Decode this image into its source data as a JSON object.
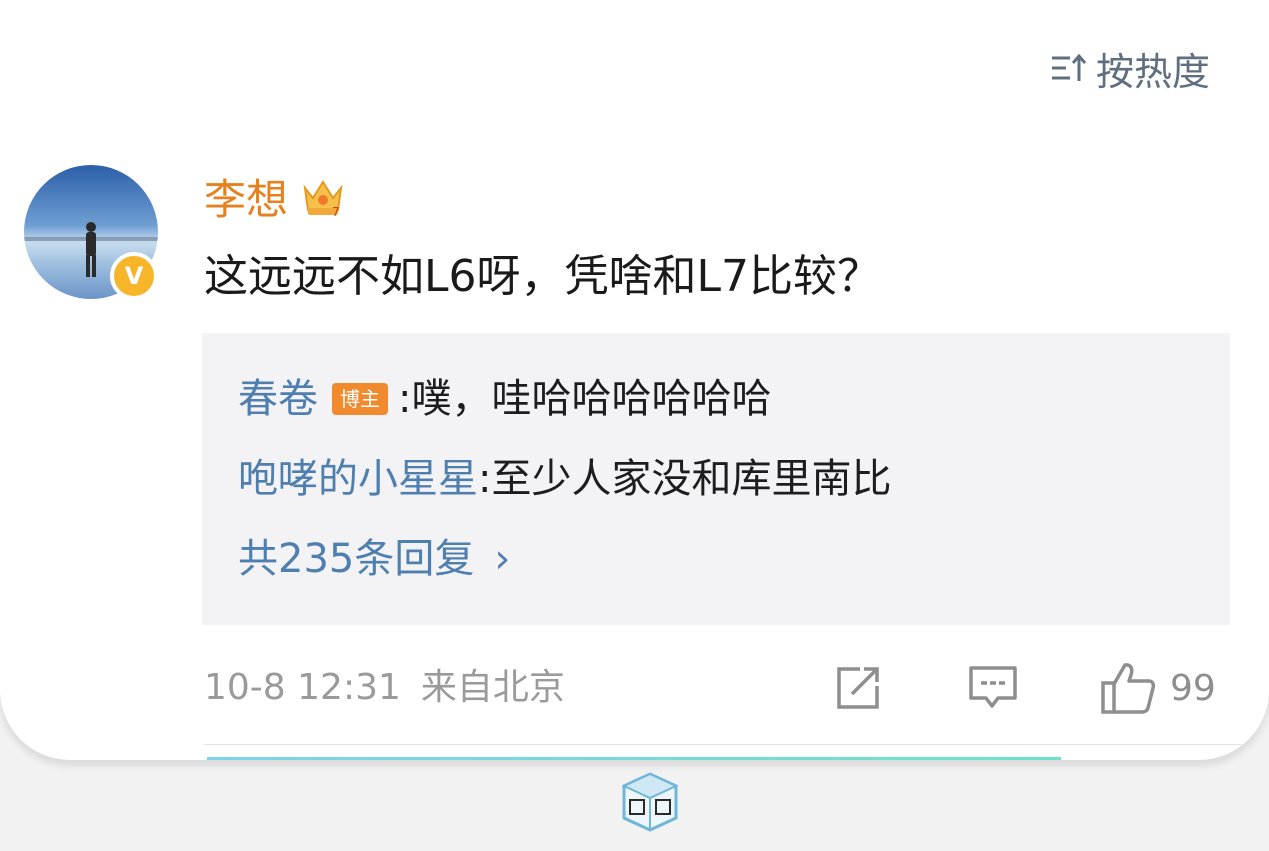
{
  "sort": {
    "icon": "sort-icon",
    "label": "按热度"
  },
  "comment": {
    "author": "李想",
    "author_color": "#e6811f",
    "crown_icon": "crown-icon",
    "verified_icon": "verified-v-badge",
    "verified_glyph": "V",
    "text": "这远远不如L6呀，凭啥和L7比较？",
    "timestamp": "10-8 12:31",
    "location": "来自北京"
  },
  "replies": [
    {
      "name": "春卷",
      "badge": "博主",
      "separator": ": ",
      "text": "噗，哇哈哈哈哈哈哈"
    },
    {
      "name": "咆哮的小星星",
      "separator": ": ",
      "text": "至少人家没和库里南比"
    }
  ],
  "more_replies": {
    "label": "共235条回复",
    "chevron": "›"
  },
  "actions": {
    "share_icon": "share-icon",
    "comment_icon": "comment-icon",
    "like_icon": "thumbs-up-icon",
    "like_count": "99"
  },
  "colors": {
    "link_blue": "#4f7fae",
    "badge_orange": "#f08a2c",
    "verify_gold": "#f7b52a"
  }
}
